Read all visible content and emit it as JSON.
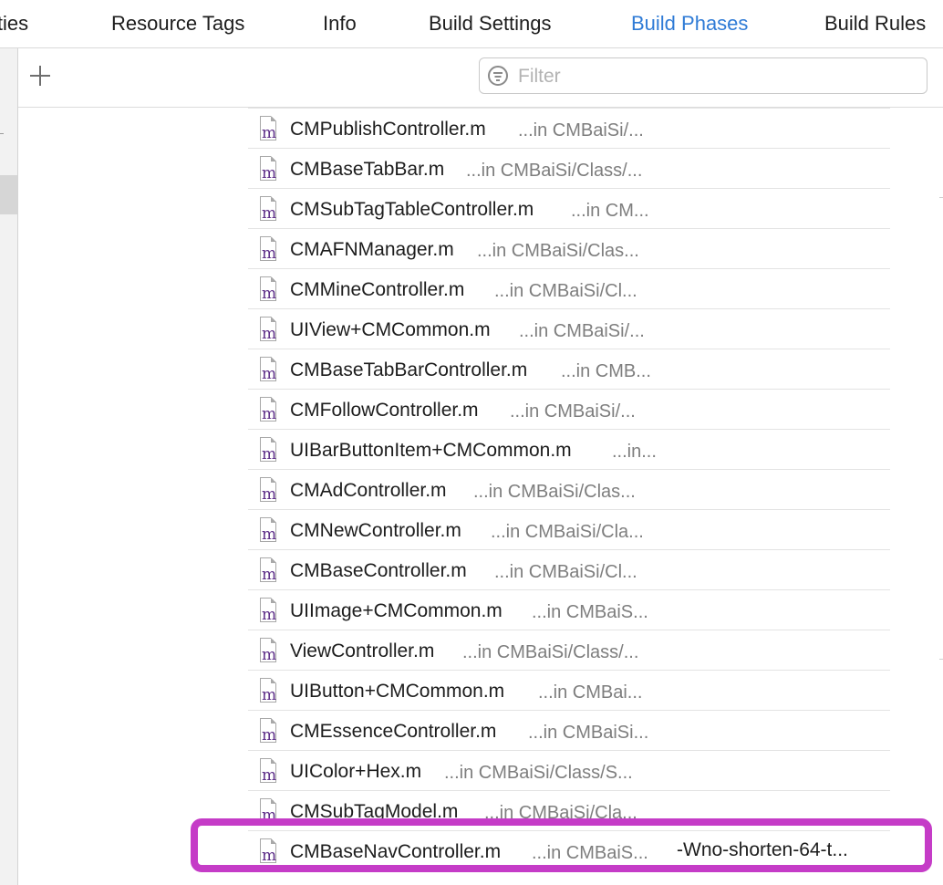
{
  "tabs": [
    {
      "label": "ities",
      "active": false
    },
    {
      "label": "Resource Tags",
      "active": false
    },
    {
      "label": "Info",
      "active": false
    },
    {
      "label": "Build Settings",
      "active": false
    },
    {
      "label": "Build Phases",
      "active": true
    },
    {
      "label": "Build Rules",
      "active": false
    }
  ],
  "toolbar": {
    "add_icon": "plus-icon",
    "filter_icon": "filter-icon",
    "filter_placeholder": "Filter",
    "filter_value": ""
  },
  "files": [
    {
      "name": "CMPublishController.m",
      "path": "...in CMBaiSi/...",
      "flags": ""
    },
    {
      "name": "CMBaseTabBar.m",
      "path": "...in CMBaiSi/Class/...",
      "flags": ""
    },
    {
      "name": "CMSubTagTableController.m",
      "path": "...in CM...",
      "flags": ""
    },
    {
      "name": "CMAFNManager.m",
      "path": "...in CMBaiSi/Clas...",
      "flags": ""
    },
    {
      "name": "CMMineController.m",
      "path": "...in CMBaiSi/Cl...",
      "flags": ""
    },
    {
      "name": "UIView+CMCommon.m",
      "path": "...in CMBaiSi/...",
      "flags": ""
    },
    {
      "name": "CMBaseTabBarController.m",
      "path": "...in CMB...",
      "flags": ""
    },
    {
      "name": "CMFollowController.m",
      "path": "...in CMBaiSi/...",
      "flags": ""
    },
    {
      "name": "UIBarButtonItem+CMCommon.m",
      "path": "...in...",
      "flags": ""
    },
    {
      "name": "CMAdController.m",
      "path": "...in CMBaiSi/Clas...",
      "flags": ""
    },
    {
      "name": "CMNewController.m",
      "path": "...in CMBaiSi/Cla...",
      "flags": ""
    },
    {
      "name": "CMBaseController.m",
      "path": "...in CMBaiSi/Cl...",
      "flags": ""
    },
    {
      "name": "UIImage+CMCommon.m",
      "path": "...in CMBaiS...",
      "flags": ""
    },
    {
      "name": "ViewController.m",
      "path": "...in CMBaiSi/Class/...",
      "flags": ""
    },
    {
      "name": "UIButton+CMCommon.m",
      "path": "...in CMBai...",
      "flags": ""
    },
    {
      "name": "CMEssenceController.m",
      "path": "...in CMBaiSi...",
      "flags": ""
    },
    {
      "name": "UIColor+Hex.m",
      "path": "...in CMBaiSi/Class/S...",
      "flags": ""
    },
    {
      "name": "CMSubTagModel.m",
      "path": "...in CMBaiSi/Cla...",
      "flags": ""
    },
    {
      "name": "CMBaseNavController.m",
      "path": "...in CMBaiS...",
      "flags": "-Wno-shorten-64-t..."
    }
  ],
  "file_icon": "objc-m-file-icon",
  "file_icon_letter": "m",
  "colors": {
    "accent": "#2f7bd6",
    "highlight": "#c53cc7",
    "path_text": "#7e7e7e"
  }
}
